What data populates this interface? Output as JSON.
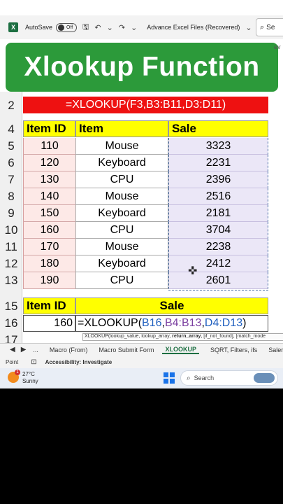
{
  "titlebar": {
    "logo": "X",
    "autosave_label": "AutoSave",
    "autosave_state": "Off",
    "title": "Advance Excel Files (Recovered)",
    "search_label": "Se",
    "search_peek": "ev"
  },
  "banner": {
    "text": "Xlookup Function"
  },
  "row_numbers": [
    "2",
    "4",
    "5",
    "6",
    "7",
    "8",
    "9",
    "10",
    "11",
    "12",
    "13",
    "15",
    "16",
    "17"
  ],
  "formula_banner": "=XLOOKUP(F3,B3:B11,D3:D11)",
  "table": {
    "headers": [
      "Item ID",
      "Item",
      "Sale"
    ],
    "rows": [
      {
        "id": "110",
        "item": "Mouse",
        "sale": "3323"
      },
      {
        "id": "120",
        "item": "Keyboard",
        "sale": "2231"
      },
      {
        "id": "130",
        "item": "CPU",
        "sale": "2396"
      },
      {
        "id": "140",
        "item": "Mouse",
        "sale": "2516"
      },
      {
        "id": "150",
        "item": "Keyboard",
        "sale": "2181"
      },
      {
        "id": "160",
        "item": "CPU",
        "sale": "3704"
      },
      {
        "id": "170",
        "item": "Mouse",
        "sale": "2238"
      },
      {
        "id": "180",
        "item": "Keyboard",
        "sale": "2412"
      },
      {
        "id": "190",
        "item": "CPU",
        "sale": "2601"
      }
    ]
  },
  "lookup": {
    "header_id": "Item ID",
    "header_sale": "Sale",
    "id_value": "160",
    "formula_prefix": "=XLOOKUP(",
    "ref1": "B16",
    "ref2": "B4:B13",
    "ref3": "D4:D13",
    "formula_suffix": ")",
    "sep": ","
  },
  "tooltip": {
    "text_a": "XLOOKUP(lookup_value, lookup_array, ",
    "text_bold": "return_array",
    "text_b": ", [if_not_found], [match_mode"
  },
  "sheet_tabs": {
    "nav_prev": "◀",
    "nav_next": "▶",
    "more": "...",
    "tabs": [
      "Macro (From)",
      "Macro Submit Form",
      "XLOOKUP",
      "SQRT, Filters, ifs",
      "Salery Sh"
    ],
    "active_index": 2
  },
  "statusbar": {
    "mode": "Point",
    "accessibility": "Accessibility: Investigate"
  },
  "taskbar": {
    "weather_badge": "1",
    "temp": "27°C",
    "condition": "Sunny",
    "search_placeholder": "Search"
  },
  "colors": {
    "banner_green": "#2c9a3a",
    "formula_red": "#ee1111",
    "header_yellow": "#ffff00",
    "id_pink": "#fde9e7",
    "sale_lavender": "#ebe7f7"
  }
}
